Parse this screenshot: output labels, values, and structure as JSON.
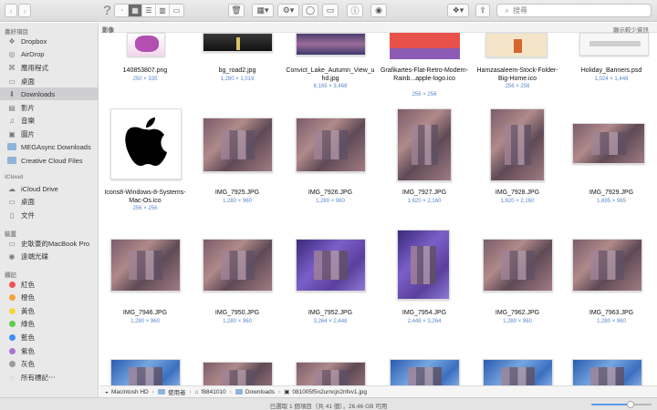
{
  "search": {
    "placeholder": "搜尋"
  },
  "sidebar": {
    "favorites_label": "喜好項目",
    "favorites": [
      "Dropbox",
      "AirDrop",
      "應用程式",
      "桌面",
      "Downloads",
      "影片",
      "音樂",
      "圖片",
      "MEGAsync Downloads",
      "Creative Cloud Files"
    ],
    "icloud_label": "iCloud",
    "icloud": [
      "iCloud Drive",
      "桌面",
      "文件"
    ],
    "devices_label": "裝置",
    "devices": [
      "史耿豪的MacBook Pro",
      "遠端光碟"
    ],
    "tags_label": "標記",
    "tags": [
      {
        "label": "紅色",
        "color": "#f0524f"
      },
      {
        "label": "橙色",
        "color": "#f5a23b"
      },
      {
        "label": "黃色",
        "color": "#f6d43e"
      },
      {
        "label": "綠色",
        "color": "#5fcc4f"
      },
      {
        "label": "藍色",
        "color": "#3d8ff0"
      },
      {
        "label": "紫色",
        "color": "#b072d9"
      },
      {
        "label": "灰色",
        "color": "#9a9a9a"
      }
    ],
    "all_tags": "所有標記⋯"
  },
  "main": {
    "section_title": "影像",
    "show_less": "顯示較少資訊",
    "row0": [
      {
        "name": "140853807.png",
        "size": "250 × 335"
      },
      {
        "name": "bg_road2.jpg",
        "size": "1,280 × 1,019"
      },
      {
        "name": "Convict_Lake_Autumn_View_u hd.jpg",
        "size": "6,165 × 3,468"
      },
      {
        "name": "Grafikartes-Flat-Retro-Modern-Rainb...apple-logo.ico",
        "size": "256 × 256"
      },
      {
        "name": "Hamzasaleem-Stock-Folder-Big-Home.ico",
        "size": "256 × 256"
      },
      {
        "name": "Holiday_Banners.psd",
        "size": "1,024 × 1,448"
      }
    ],
    "row1": [
      {
        "name": "Icons8-Windows-8-Systems-Mac-Os.ico",
        "size": "256 × 256"
      },
      {
        "name": "IMG_7925.JPG",
        "size": "1,280 × 960"
      },
      {
        "name": "IMG_7926.JPG",
        "size": "1,280 × 960"
      },
      {
        "name": "IMG_7927.JPG",
        "size": "1,620 × 2,160"
      },
      {
        "name": "IMG_7928.JPG",
        "size": "1,620 × 2,160"
      },
      {
        "name": "IMG_7929.JPG",
        "size": "1,695 × 965"
      }
    ],
    "row2": [
      {
        "name": "IMG_7946.JPG",
        "size": "1,280 × 960"
      },
      {
        "name": "IMG_7950.JPG",
        "size": "1,280 × 960"
      },
      {
        "name": "IMG_7952.JPG",
        "size": "3,264 × 2,448"
      },
      {
        "name": "IMG_7954.JPG",
        "size": "2,448 × 3,264"
      },
      {
        "name": "IMG_7962.JPG",
        "size": "1,280 × 960"
      },
      {
        "name": "IMG_7963.JPG",
        "size": "1,280 × 960"
      }
    ]
  },
  "pathbar": [
    "Macintosh HD",
    "使用者",
    "f8841010",
    "Downloads",
    "081005f5n2urncjn2nfvv1.jpg"
  ],
  "status": {
    "text": "已選取 1 個項目（共 41 個），26.46 GB 可用",
    "zoom": 0.65
  }
}
